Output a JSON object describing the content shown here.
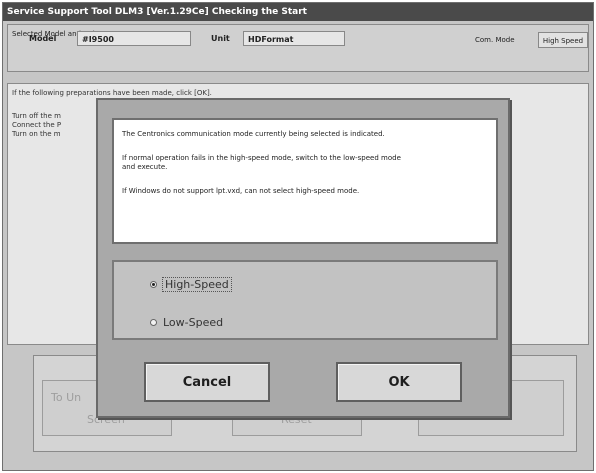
{
  "window": {
    "title": "Service Support Tool DLM3 [Ver.1.29Ce] Checking the Start"
  },
  "selection": {
    "label": "Selected Model and Unit",
    "model_label": "Model",
    "model_value": "#I9500",
    "unit_label": "Unit",
    "unit_value": "HDFormat",
    "comm_mode_label": "Com. Mode",
    "comm_mode_value": "High Speed"
  },
  "instructions": {
    "intro": "If the following preparations have been made, click [OK].",
    "lines": [
      "Turn off the m",
      "Connect the P",
      "Turn on the m"
    ]
  },
  "background_buttons": {
    "b1_line1": "To Un",
    "b1_line2": "Screen",
    "b2_label": "Reset"
  },
  "dialog": {
    "messages": [
      "The Centronics communication mode currently being selected is indicated.",
      "If normal operation fails in the high-speed mode, switch to the low-speed mode",
      "and execute.",
      "If Windows do not support lpt.vxd, can not select high-speed mode."
    ],
    "options": [
      "High-Speed",
      "Low-Speed"
    ],
    "selected_option": "High-Speed",
    "cancel_label": "Cancel",
    "ok_label": "OK"
  }
}
